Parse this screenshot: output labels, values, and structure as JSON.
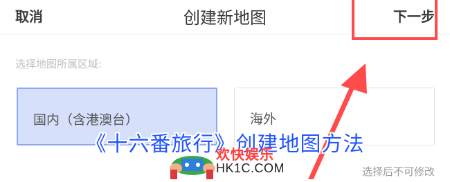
{
  "header": {
    "cancel_label": "取消",
    "title": "创建新地图",
    "next_label": "下一步"
  },
  "region": {
    "label": "选择地图所属区域:",
    "options": [
      {
        "label": "国内（含港澳台）",
        "selected": true
      },
      {
        "label": "海外",
        "selected": false
      }
    ],
    "footnote": "选择后不可修改"
  },
  "overlay": {
    "title": "《十六番旅行》创建地图方法",
    "logo_text": "欢快娱乐",
    "logo_domain": "HK1C.COM"
  },
  "colors": {
    "accent_red": "#ff4b4b",
    "selected_bg": "#d7e0fa",
    "selected_border": "#8fa6f0",
    "watermark_blue": "#2255ff"
  }
}
